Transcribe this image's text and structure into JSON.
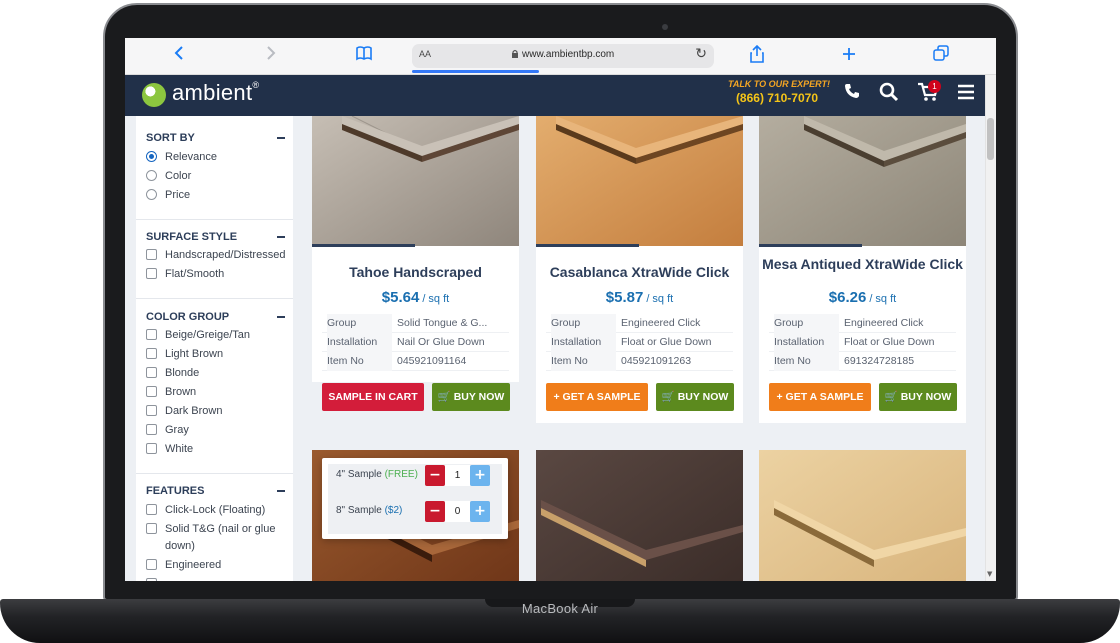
{
  "device": {
    "label": "MacBook Air"
  },
  "browser": {
    "back_icon": "chevron-left-icon",
    "forward_icon": "chevron-right-icon",
    "bookmarks_icon": "book-icon",
    "text_size_label": "AA",
    "url": "www.ambientbp.com",
    "reload_icon": "reload-icon",
    "share_icon": "share-icon",
    "new_tab_icon": "plus-icon",
    "tabs_icon": "tabs-icon",
    "load_progress": 0.42
  },
  "header": {
    "brand": "ambient",
    "brand_mark": "®",
    "expert_label": "TALK TO OUR EXPERT!",
    "phone": "(866) 710-7070",
    "cart_count": "1",
    "colors": {
      "bar": "#213049",
      "accent": "#f5a623",
      "badge": "#d0021b"
    }
  },
  "sidebar": {
    "sort": {
      "title": "SORT BY",
      "options": [
        "Relevance",
        "Color",
        "Price"
      ],
      "selected": "Relevance"
    },
    "surface_style": {
      "title": "SURFACE STYLE",
      "options": [
        "Handscraped/Distressed",
        "Flat/Smooth"
      ]
    },
    "color_group": {
      "title": "COLOR GROUP",
      "options": [
        "Beige/Greige/Tan",
        "Light Brown",
        "Blonde",
        "Brown",
        "Dark Brown",
        "Gray",
        "White"
      ]
    },
    "features": {
      "title": "FEATURES",
      "options": [
        "Click-Lock (Floating)",
        "Solid T&G (nail or glue",
        "down)",
        "Engineered"
      ]
    }
  },
  "products": [
    {
      "name": "Tahoe Handscraped",
      "price": "$5.64",
      "unit": "/ sq ft",
      "specs": [
        {
          "key": "Group",
          "value": "Solid Tongue & G..."
        },
        {
          "key": "Installation",
          "value": "Nail Or Glue Down"
        },
        {
          "key": "Item No",
          "value": "045921091164"
        }
      ],
      "sample_button": "SAMPLE IN CART",
      "buy_button": "BUY NOW",
      "tone": "#b7ada3"
    },
    {
      "name": "Casablanca XtraWide Click",
      "price": "$5.87",
      "unit": "/ sq ft",
      "specs": [
        {
          "key": "Group",
          "value": "Engineered Click"
        },
        {
          "key": "Installation",
          "value": "Float or Glue Down"
        },
        {
          "key": "Item No",
          "value": "045921091263"
        }
      ],
      "sample_button": "+ GET A SAMPLE",
      "buy_button": "BUY NOW",
      "tone": "#d89a5e"
    },
    {
      "name": "Mesa Antiqued XtraWide Click",
      "price": "$6.26",
      "unit": "/ sq ft",
      "specs": [
        {
          "key": "Group",
          "value": "Engineered Click"
        },
        {
          "key": "Installation",
          "value": "Float or Glue Down"
        },
        {
          "key": "Item No",
          "value": "691324728185"
        }
      ],
      "sample_button": "+ GET A SAMPLE",
      "buy_button": "BUY NOW",
      "tone": "#a9a396"
    }
  ],
  "bottom_row_tones": [
    "#8a4a22",
    "#4a3a35",
    "#e2c08c"
  ],
  "sample_popover": {
    "rows": [
      {
        "label": "4\" Sample",
        "price": "(FREE)",
        "qty": "1"
      },
      {
        "label": "8\" Sample",
        "price": "($2)",
        "qty": "0"
      }
    ],
    "minus": "−",
    "plus": "+"
  }
}
